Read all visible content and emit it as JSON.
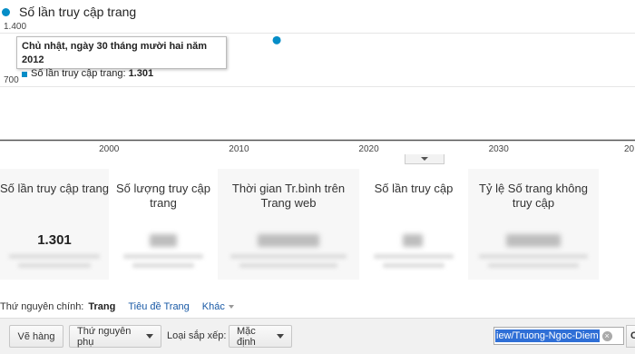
{
  "legend": {
    "label": "Số lần truy cập trang",
    "color": "#058dc7",
    "icon": "series-dot-icon"
  },
  "chart_data": {
    "type": "scatter",
    "series": [
      {
        "name": "Số lần truy cập trang",
        "x": [
          2012.91
        ],
        "y": [
          1301
        ]
      }
    ],
    "y_ticks": [
      "1.400",
      "700"
    ],
    "y_tick_values": [
      1400,
      700
    ],
    "x_ticks": [
      "2000",
      "2010",
      "2020",
      "2030",
      "20"
    ],
    "x_tick_values": [
      2000,
      2010,
      2020,
      2030,
      2040
    ],
    "xlim": [
      1991.6,
      2040.5
    ],
    "ylim": [
      0,
      1400
    ],
    "grid": true,
    "title": "",
    "xlabel": "",
    "ylabel": "",
    "tooltip": {
      "title": "Chủ nhật, ngày 30 tháng mười hai năm 2012",
      "series_label": "Số lần truy cập trang:",
      "value": "1.301"
    }
  },
  "metrics": [
    {
      "label": "Số lần truy cập trang",
      "value": "1.301"
    },
    {
      "label": "Số lượng truy cập trang",
      "value": ""
    },
    {
      "label": "Thời gian Tr.bình trên Trang web",
      "value": ""
    },
    {
      "label": "Số lần truy cập",
      "value": ""
    },
    {
      "label": "Tỷ lệ Số trang không truy cập",
      "value": ""
    }
  ],
  "dimensions": {
    "label": "Thứ nguyên chính:",
    "active": "Trang",
    "link": "Tiêu đề Trang",
    "other": "Khác"
  },
  "toolbar": {
    "plot_rows": "Vẽ hàng",
    "secondary_dimension": "Thứ nguyên phụ",
    "sort_type_label": "Loại sắp xếp:",
    "sort_type_value": "Mặc định",
    "search_value": "iew/Truong-Ngoc-Diem",
    "go_label": "C"
  },
  "colors": {
    "series": "#058dc7",
    "link": "#1a5aa6",
    "selection": "#2f6fd6"
  }
}
